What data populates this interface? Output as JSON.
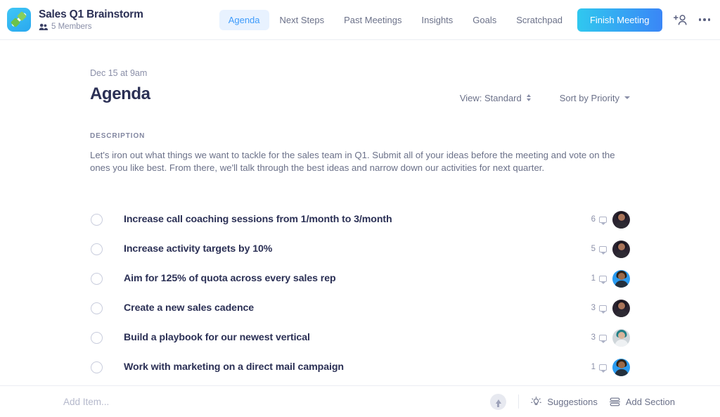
{
  "header": {
    "logo_icon": "brush-diamond-logo-icon",
    "meeting_title": "Sales Q1 Brainstorm",
    "members_icon": "people-icon",
    "members_text": "5 Members",
    "tabs": [
      {
        "label": "Agenda",
        "active": true
      },
      {
        "label": "Next Steps",
        "active": false
      },
      {
        "label": "Past Meetings",
        "active": false
      },
      {
        "label": "Insights",
        "active": false
      },
      {
        "label": "Goals",
        "active": false
      },
      {
        "label": "Scratchpad",
        "active": false
      }
    ],
    "finish_button": "Finish Meeting",
    "add_person_icon": "add-person-icon",
    "more_icon": "more-horizontal-icon",
    "accent_color": "#3d9bfb",
    "active_tab_bg": "#e8f2ff",
    "button_gradient_from": "#30c8ef",
    "button_gradient_to": "#3a86f7"
  },
  "main": {
    "date": "Dec 15 at 9am",
    "title": "Agenda",
    "view_control": {
      "label": "View: Standard",
      "icon": "up-down-stepper-icon"
    },
    "sort_control": {
      "label": "Sort by Priority",
      "icon": "chevron-down-icon"
    },
    "description_label": "DESCRIPTION",
    "description_text": "Let's iron out what things we want to tackle for the sales team in Q1. Submit all of your ideas before the meeting and vote on the ones you like best. From there, we'll talk through the best ideas and narrow down our activities for next quarter.",
    "items": [
      {
        "text": "Increase call coaching sessions from 1/month to 3/month",
        "comments": "6",
        "avatar": {
          "bg": "#2a2330",
          "hair": "#1b1620",
          "skin": "#a9745a",
          "body": "#2d2a33"
        }
      },
      {
        "text": "Increase activity targets by 10%",
        "comments": "5",
        "avatar": {
          "bg": "#2a2330",
          "hair": "#1b1620",
          "skin": "#a9745a",
          "body": "#2d2a33"
        }
      },
      {
        "text": "Aim for 125% of quota across every sales rep",
        "comments": "1",
        "avatar": {
          "bg": "#2a9bf0",
          "hair": "#2b2119",
          "skin": "#9b6a4a",
          "body": "#24303d"
        }
      },
      {
        "text": "Create a new sales cadence",
        "comments": "3",
        "avatar": {
          "bg": "#2a2330",
          "hair": "#1b1620",
          "skin": "#a9745a",
          "body": "#2d2a33"
        }
      },
      {
        "text": "Build a playbook for our newest vertical",
        "comments": "3",
        "avatar": {
          "bg": "#cfd6da",
          "hair": "#1f7f86",
          "skin": "#d8b49a",
          "body": "#eef1f3"
        }
      },
      {
        "text": "Work with marketing on a direct mail campaign",
        "comments": "1",
        "avatar": {
          "bg": "#2a9bf0",
          "hair": "#2b2119",
          "skin": "#9b6a4a",
          "body": "#24303d"
        }
      }
    ]
  },
  "footer": {
    "add_item_placeholder": "Add Item...",
    "add_item_value": "",
    "submit_icon": "arrow-up-circle-icon",
    "suggestions": {
      "label": "Suggestions",
      "icon": "lightbulb-icon"
    },
    "add_section": {
      "label": "Add Section",
      "icon": "sections-icon"
    }
  }
}
